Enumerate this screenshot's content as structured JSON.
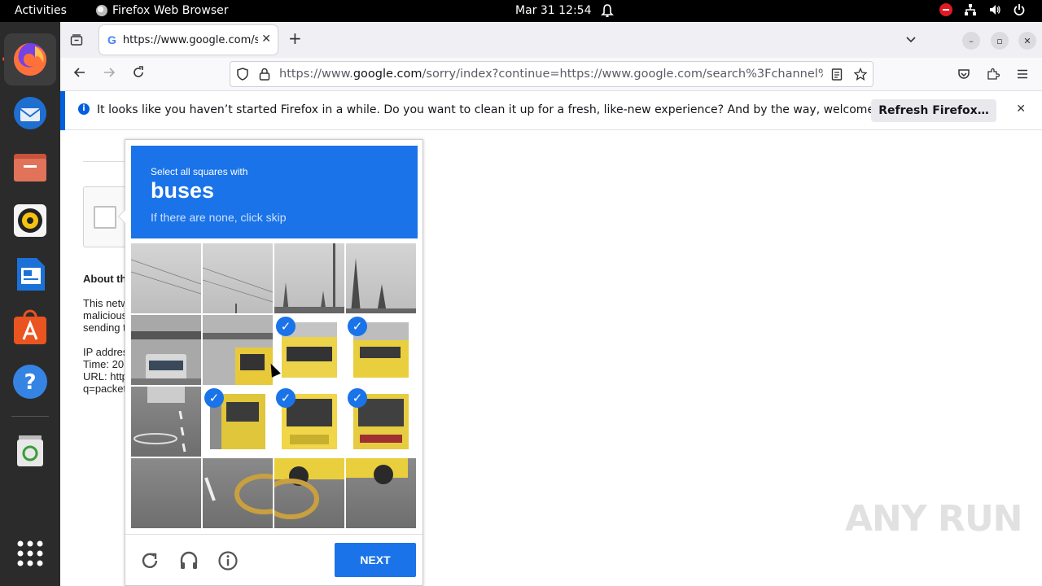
{
  "topbar": {
    "activities": "Activities",
    "app_name": "Firefox Web Browser",
    "clock": "Mar 31  12:54"
  },
  "dock": {
    "items": [
      "Firefox",
      "Thunderbird",
      "Files",
      "Rhythmbox",
      "LibreOffice Writer",
      "Ubuntu Software",
      "Help",
      "Trash",
      "Show Applications"
    ]
  },
  "browser": {
    "tab_title": "https://www.google.com/sorry/index?continue",
    "url_prefix": "https://www.",
    "url_domain": "google.com",
    "url_rest": "/sorry/index?continue=https://www.google.com/search%3Fchannel%3",
    "notification": "It looks like you haven’t started Firefox in a while. Do you want to clean it up for a fresh, like-new experience? And by the way, welcome back!",
    "refresh_button": "Refresh Firefox…"
  },
  "page": {
    "about_heading": "About th",
    "paragraph_lines": [
      "This netw",
      "malicious",
      "sending t"
    ],
    "info_lines": [
      "IP addres",
      "Time: 20",
      "URL: http",
      "q=packet"
    ]
  },
  "captcha": {
    "instruction_line1": "Select all squares with",
    "target": "buses",
    "instruction_line3": "If there are none, click skip",
    "next_button": "NEXT",
    "selected_cells": [
      6,
      7,
      9,
      10,
      11
    ],
    "checkmark": "✓"
  },
  "watermark": "ANY RUN"
}
